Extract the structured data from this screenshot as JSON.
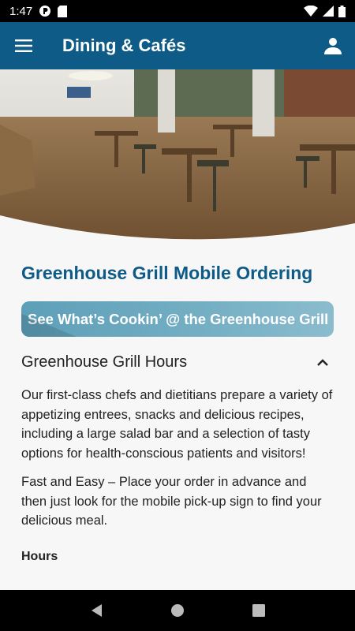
{
  "status_bar": {
    "time": "1:47"
  },
  "app_bar": {
    "title": "Dining & Cafés"
  },
  "main": {
    "heading": "Greenhouse Grill Mobile Ordering",
    "banner_text": "See What’s Cookin’ @ the Greenhouse Grill",
    "section_title": "Greenhouse Grill Hours",
    "paragraphs": [
      "Our first-class chefs and dietitians prepare a variety of appetizing entrees, snacks and delicious recipes, including a large salad bar and a selection of tasty options for health-conscious patients and visitors!",
      "Fast and Easy – Place your order in advance and then just look for the mobile pick-up sign to find your delicious meal."
    ],
    "hours_label": "Hours"
  },
  "colors": {
    "brand": "#0d5b86",
    "banner": "#75afc4"
  },
  "icons": [
    "menu-icon",
    "account-icon",
    "chevron-up-icon",
    "back-icon",
    "home-icon",
    "recents-icon"
  ]
}
